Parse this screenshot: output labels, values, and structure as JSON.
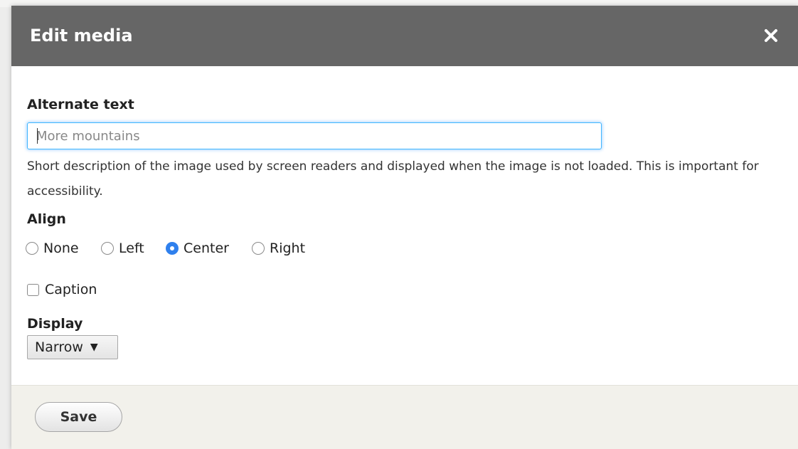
{
  "dialog": {
    "title": "Edit media",
    "close_icon": "close-icon"
  },
  "alt_text": {
    "label": "Alternate text",
    "value": "",
    "placeholder": "More mountains",
    "description": "Short description of the image used by screen readers and displayed when the image is not loaded. This is important for accessibility."
  },
  "align": {
    "label": "Align",
    "options": [
      {
        "label": "None",
        "selected": false
      },
      {
        "label": "Left",
        "selected": false
      },
      {
        "label": "Center",
        "selected": true
      },
      {
        "label": "Right",
        "selected": false
      }
    ]
  },
  "caption": {
    "label": "Caption",
    "checked": false
  },
  "display": {
    "label": "Display",
    "selected": "Narrow",
    "arrow": "▼"
  },
  "footer": {
    "save_label": "Save"
  },
  "colors": {
    "titlebar": "#666666",
    "accent": "#2f80ed",
    "focus_ring": "#40b6ff",
    "footer": "#f2f1eb"
  }
}
